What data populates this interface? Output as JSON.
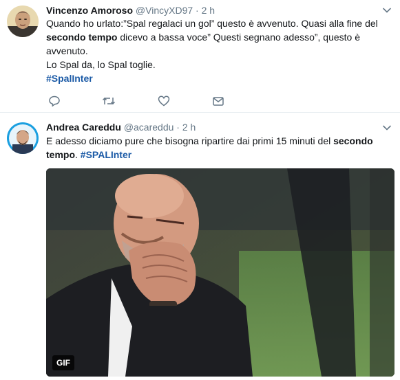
{
  "tweets": [
    {
      "name": "Vincenzo Amoroso",
      "handle": "@VincyXD97",
      "separator": "·",
      "time": "2 h",
      "text_line1": "Quando ho urlato:”Spal regalaci un gol” questo è avvenuto. Quasi alla fine del",
      "text_bold": "secondo tempo",
      "text_line2_rest": " dicevo a bassa voce” Questi segnano adesso”, questo è",
      "text_line3": "avvenuto.",
      "text_line4": "Lo Spal da, lo Spal toglie.",
      "hashtag": "#SpalInter",
      "actions": [
        "reply-icon",
        "retweet-icon",
        "like-icon",
        "direct-message-icon"
      ]
    },
    {
      "name": "Andrea Careddu",
      "handle": "@acareddu",
      "separator": "·",
      "time": "2 h",
      "text_pre": "E adesso diciamo pure che bisogna ripartire dai primi 15 minuti del ",
      "text_bold1": "secondo",
      "text_bold2": "tempo",
      "text_after": ". ",
      "hashtag": "#SPALInter",
      "media_badge": "GIF"
    }
  ],
  "colors": {
    "link": "#1b5aa6",
    "muted": "#657786",
    "divider": "#e6ecf0"
  }
}
